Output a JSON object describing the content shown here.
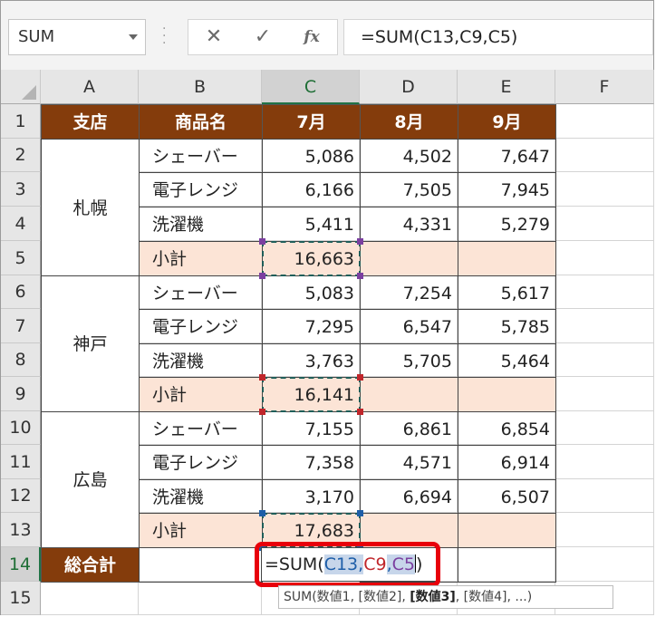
{
  "name_box": {
    "value": "SUM"
  },
  "formula_bar": {
    "cancel_icon": "close-icon",
    "enter_icon": "check-icon",
    "fx_label": "fx",
    "value": "=SUM(C13,C9,C5)"
  },
  "columns": [
    "A",
    "B",
    "C",
    "D",
    "E",
    "F"
  ],
  "rows": [
    "1",
    "2",
    "3",
    "4",
    "5",
    "6",
    "7",
    "8",
    "9",
    "10",
    "11",
    "12",
    "13",
    "14",
    "15"
  ],
  "header_row": [
    "支店",
    "商品名",
    "7月",
    "8月",
    "9月"
  ],
  "branches": [
    "札幌",
    "神戸",
    "広島"
  ],
  "items": [
    {
      "name": "シェーバー",
      "jul": "5,086",
      "aug": "4,502",
      "sep": "7,647"
    },
    {
      "name": "電子レンジ",
      "jul": "6,166",
      "aug": "7,505",
      "sep": "7,945"
    },
    {
      "name": "洗濯機",
      "jul": "5,411",
      "aug": "4,331",
      "sep": "5,279"
    },
    {
      "name": "小計",
      "jul": "16,663",
      "aug": "",
      "sep": ""
    },
    {
      "name": "シェーバー",
      "jul": "5,083",
      "aug": "7,254",
      "sep": "5,617"
    },
    {
      "name": "電子レンジ",
      "jul": "7,295",
      "aug": "6,547",
      "sep": "5,785"
    },
    {
      "name": "洗濯機",
      "jul": "3,763",
      "aug": "5,705",
      "sep": "5,464"
    },
    {
      "name": "小計",
      "jul": "16,141",
      "aug": "",
      "sep": ""
    },
    {
      "name": "シェーバー",
      "jul": "7,155",
      "aug": "6,861",
      "sep": "6,854"
    },
    {
      "name": "電子レンジ",
      "jul": "7,358",
      "aug": "4,571",
      "sep": "6,914"
    },
    {
      "name": "洗濯機",
      "jul": "3,170",
      "aug": "6,694",
      "sep": "6,507"
    },
    {
      "name": "小計",
      "jul": "17,683",
      "aug": "",
      "sep": ""
    }
  ],
  "total_label": "総合計",
  "editing": {
    "prefix": "=SUM(",
    "ref1": "C13",
    "comma1": ",",
    "ref2": "C9",
    "comma2": ",",
    "ref3": "C5",
    "suffix": ")"
  },
  "tooltip": {
    "pre": "SUM(数値1, [数値2], ",
    "bold": "[数値3]",
    "post": ", [数値4], ...)"
  },
  "colors": {
    "header_fill": "#843c0c",
    "subtotal_fill": "#fce4d6",
    "highlight_box": "#e8000b",
    "ref1_color": "#1e5ea8",
    "ref2_color": "#c0262b",
    "ref3_color": "#7b3fa0"
  }
}
